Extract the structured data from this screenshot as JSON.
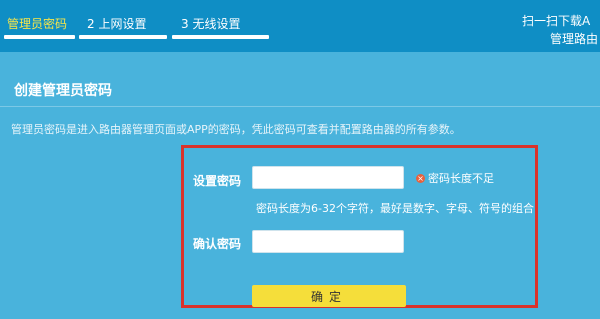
{
  "header": {
    "steps": [
      {
        "label": "管理员密码",
        "active": true
      },
      {
        "label": "2 上网设置",
        "active": false
      },
      {
        "label": "3 无线设置",
        "active": false
      }
    ],
    "qr_line1": "扫一扫下载A",
    "qr_line2": "管理路由"
  },
  "section": {
    "title": "创建管理员密码",
    "description": "管理员密码是进入路由器管理页面或APP的密码，凭此密码可查看并配置路由器的所有参数。"
  },
  "form": {
    "password_label": "设置密码",
    "password_value": "",
    "error_message": "密码长度不足",
    "hint": "密码长度为6-32个字符，最好是数字、字母、符号的组合",
    "confirm_label": "确认密码",
    "confirm_value": "",
    "submit_label": "确定"
  },
  "colors": {
    "header_bg": "#0f8ec5",
    "page_bg": "#49b3dc",
    "active_step": "#f7e64a",
    "highlight_border": "#d9322c",
    "button_bg": "#f5de3a"
  }
}
